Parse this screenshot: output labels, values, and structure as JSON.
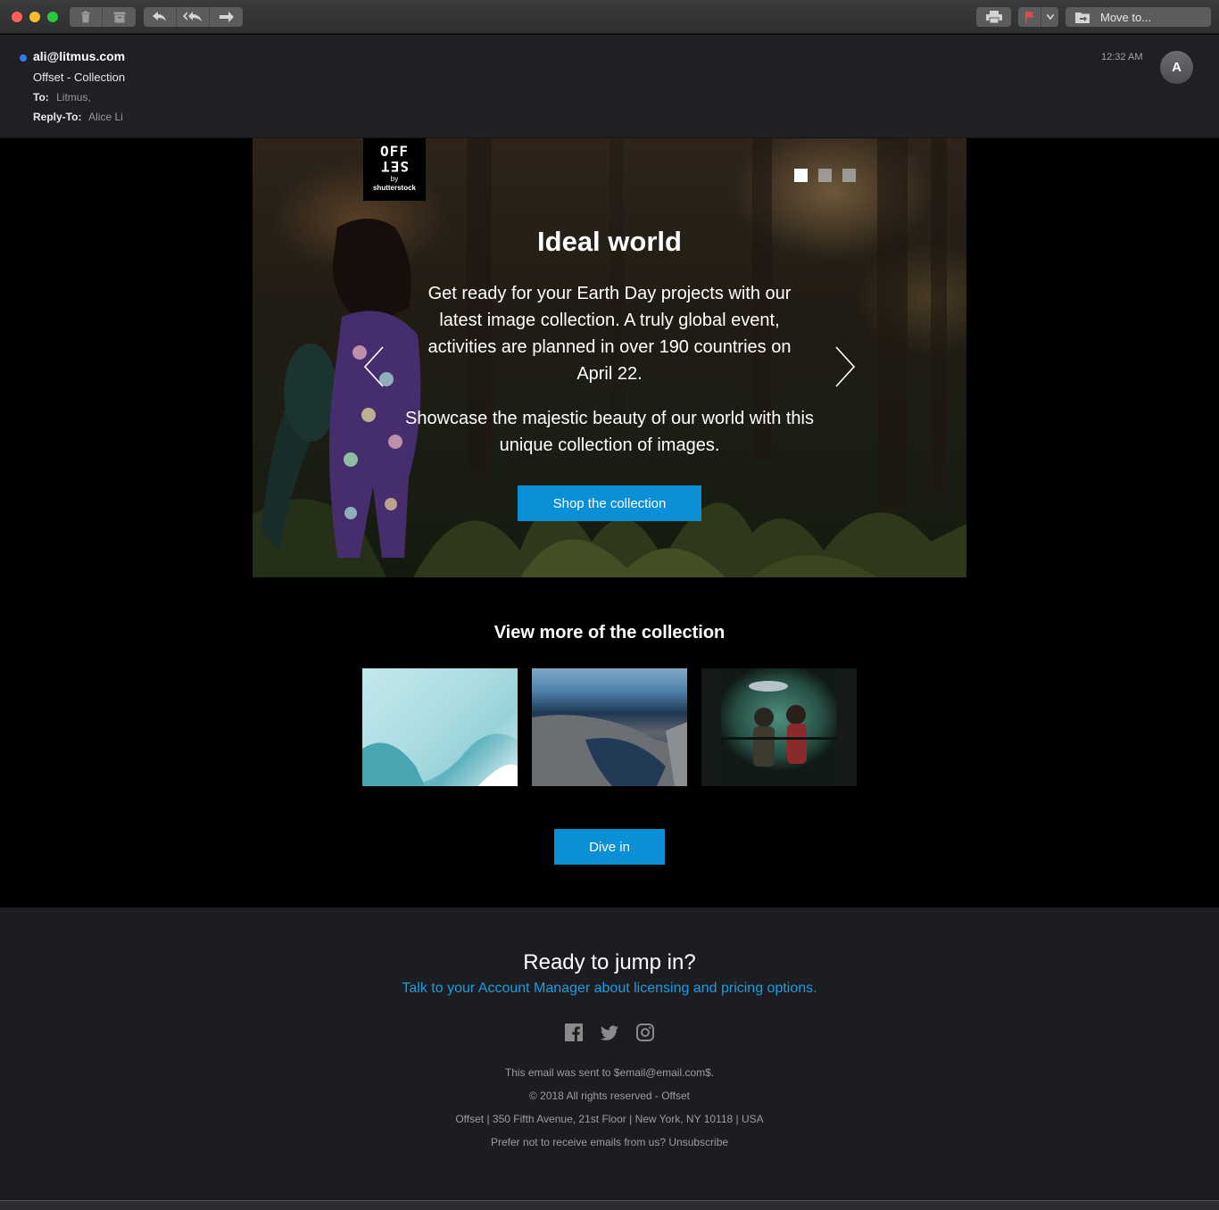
{
  "toolbar": {
    "move_to_label": "Move to..."
  },
  "header": {
    "from": "ali@litmus.com",
    "subject": "Offset - Collection",
    "to_label": "To:",
    "to_value": "Litmus,",
    "reply_to_label": "Reply-To:",
    "reply_to_value": "Alice Li",
    "time": "12:32 AM",
    "avatar_initial": "A"
  },
  "hero": {
    "logo": {
      "line1": "OFF",
      "line2": "SET",
      "line3": "by",
      "line4": "shutterstock"
    },
    "title": "Ideal world",
    "paragraph1": "Get ready for your Earth Day projects with our latest image collection. A truly global event, activities are planned in over 190 countries on April 22.",
    "paragraph2": "Showcase the majestic beauty of our world with this unique collection of images.",
    "cta": "Shop the collection",
    "carousel": {
      "slides": 3,
      "active_index": 0
    }
  },
  "collection": {
    "title": "View more of the collection",
    "thumbnails": [
      "iceberg",
      "rocky-shore",
      "aquarium-children"
    ],
    "cta": "Dive in"
  },
  "footer": {
    "heading": "Ready to jump in?",
    "link": "Talk to your Account Manager about licensing and pricing options.",
    "social": [
      "facebook-icon",
      "twitter-icon",
      "instagram-icon"
    ],
    "sent_to": "This email was sent to $email@email.com$.",
    "copyright": "© 2018 All rights reserved - Offset",
    "address": "Offset | 350 Fifth Avenue, 21st Floor | New York, NY 10118 | USA",
    "unsubscribe": "Prefer not to receive emails from us? Unsubscribe"
  },
  "colors": {
    "accent_button": "#0b8fd6",
    "link": "#1a9ee4",
    "unread_dot": "#2f7bf5",
    "footer_bg": "#1c1d21"
  }
}
